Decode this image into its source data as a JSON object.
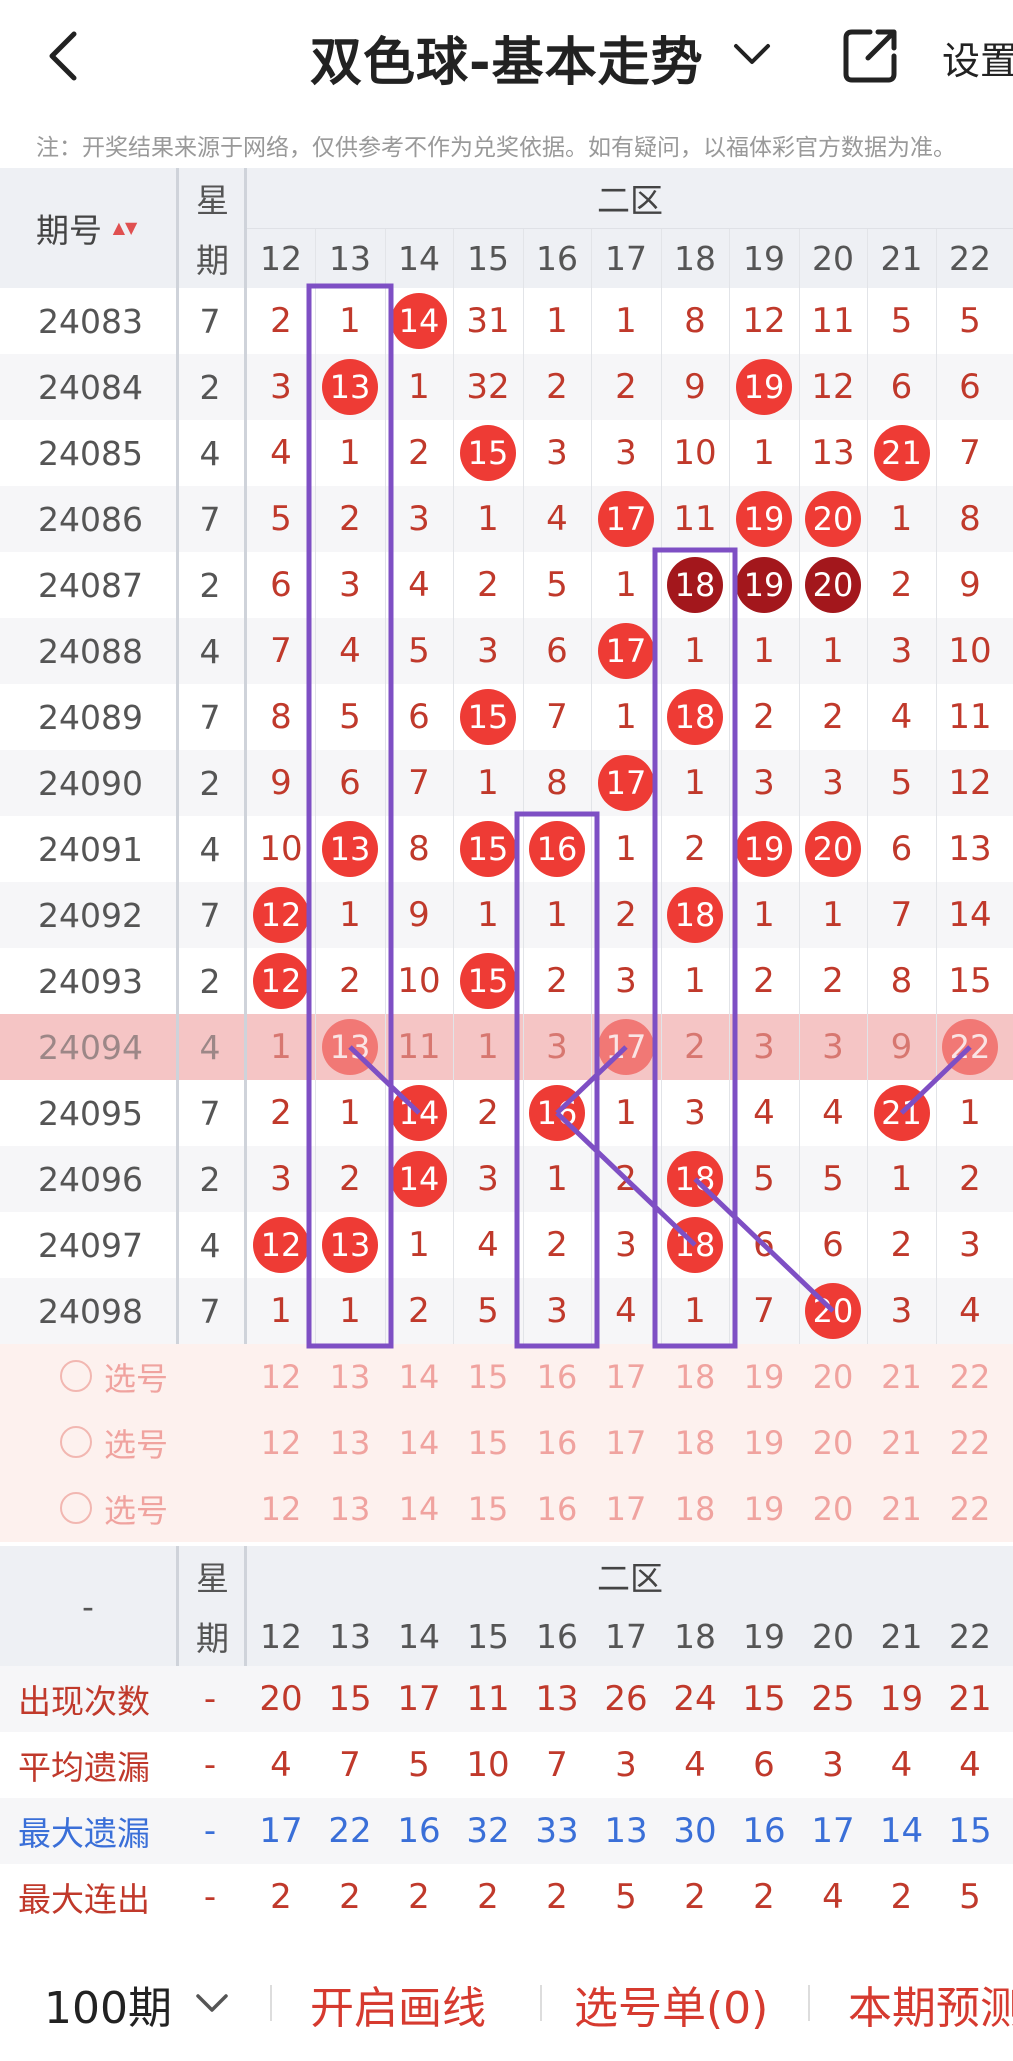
{
  "header": {
    "title": "双色球-基本走势",
    "settings_label": "设置",
    "notice": "注：开奖结果来源于网络，仅供参考不作为兑奖依据。如有疑问，以福体彩官方数据为准。"
  },
  "table": {
    "issue_header": "期号",
    "sort_arrow": "▲▼",
    "week_header": [
      "星",
      "期"
    ],
    "zone_label": "二区",
    "columns": [
      "12",
      "13",
      "14",
      "15",
      "16",
      "17",
      "18",
      "19",
      "20",
      "21",
      "22"
    ],
    "rows": [
      {
        "issue": "24083",
        "week": "7",
        "cells": [
          "2",
          "1",
          "14",
          "31",
          "1",
          "1",
          "8",
          "12",
          "11",
          "5",
          "5"
        ]
      },
      {
        "issue": "24084",
        "week": "2",
        "cells": [
          "3",
          "13",
          "1",
          "32",
          "2",
          "2",
          "9",
          "19",
          "12",
          "6",
          "6"
        ]
      },
      {
        "issue": "24085",
        "week": "4",
        "cells": [
          "4",
          "1",
          "2",
          "15",
          "3",
          "3",
          "10",
          "1",
          "13",
          "21",
          "7"
        ]
      },
      {
        "issue": "24086",
        "week": "7",
        "cells": [
          "5",
          "2",
          "3",
          "1",
          "4",
          "17",
          "11",
          "19",
          "20",
          "1",
          "8"
        ]
      },
      {
        "issue": "24087",
        "week": "2",
        "cells": [
          "6",
          "3",
          "4",
          "2",
          "5",
          "1",
          "18",
          "19",
          "20",
          "2",
          "9"
        ]
      },
      {
        "issue": "24088",
        "week": "4",
        "cells": [
          "7",
          "4",
          "5",
          "3",
          "6",
          "17",
          "1",
          "1",
          "1",
          "3",
          "10"
        ]
      },
      {
        "issue": "24089",
        "week": "7",
        "cells": [
          "8",
          "5",
          "6",
          "15",
          "7",
          "1",
          "18",
          "2",
          "2",
          "4",
          "11"
        ]
      },
      {
        "issue": "24090",
        "week": "2",
        "cells": [
          "9",
          "6",
          "7",
          "1",
          "8",
          "17",
          "1",
          "3",
          "3",
          "5",
          "12"
        ]
      },
      {
        "issue": "24091",
        "week": "4",
        "cells": [
          "10",
          "13",
          "8",
          "15",
          "16",
          "1",
          "2",
          "19",
          "20",
          "6",
          "13"
        ]
      },
      {
        "issue": "24092",
        "week": "7",
        "cells": [
          "12",
          "1",
          "9",
          "1",
          "1",
          "2",
          "18",
          "1",
          "1",
          "7",
          "14"
        ]
      },
      {
        "issue": "24093",
        "week": "2",
        "cells": [
          "12",
          "2",
          "10",
          "15",
          "2",
          "3",
          "1",
          "2",
          "2",
          "8",
          "15"
        ]
      },
      {
        "issue": "24094",
        "week": "4",
        "cells": [
          "1",
          "13",
          "11",
          "1",
          "3",
          "17",
          "2",
          "3",
          "3",
          "9",
          "22"
        ]
      },
      {
        "issue": "24095",
        "week": "7",
        "cells": [
          "2",
          "1",
          "14",
          "2",
          "16",
          "1",
          "3",
          "4",
          "4",
          "21",
          "1"
        ]
      },
      {
        "issue": "24096",
        "week": "2",
        "cells": [
          "3",
          "2",
          "14",
          "3",
          "1",
          "2",
          "18",
          "5",
          "5",
          "1",
          "2"
        ]
      },
      {
        "issue": "24097",
        "week": "4",
        "cells": [
          "12",
          "13",
          "1",
          "4",
          "2",
          "3",
          "18",
          "6",
          "6",
          "2",
          "3"
        ]
      },
      {
        "issue": "24098",
        "week": "7",
        "cells": [
          "1",
          "1",
          "2",
          "5",
          "3",
          "4",
          "1",
          "7",
          "20",
          "3",
          "4"
        ]
      }
    ],
    "balls": [
      [
        0,
        2
      ],
      [
        1,
        1
      ],
      [
        1,
        7
      ],
      [
        2,
        3
      ],
      [
        2,
        9
      ],
      [
        3,
        5
      ],
      [
        3,
        7
      ],
      [
        3,
        8
      ],
      [
        4,
        6
      ],
      [
        4,
        7
      ],
      [
        4,
        8
      ],
      [
        5,
        5
      ],
      [
        6,
        3
      ],
      [
        6,
        6
      ],
      [
        7,
        5
      ],
      [
        8,
        1
      ],
      [
        8,
        3
      ],
      [
        8,
        4
      ],
      [
        8,
        7
      ],
      [
        8,
        8
      ],
      [
        9,
        0
      ],
      [
        9,
        6
      ],
      [
        10,
        0
      ],
      [
        10,
        3
      ],
      [
        11,
        1
      ],
      [
        11,
        5
      ],
      [
        11,
        10
      ],
      [
        12,
        2
      ],
      [
        12,
        4
      ],
      [
        12,
        9
      ],
      [
        13,
        2
      ],
      [
        13,
        6
      ],
      [
        14,
        0
      ],
      [
        14,
        1
      ],
      [
        14,
        6
      ],
      [
        15,
        8
      ]
    ],
    "dark_balls": [
      [
        4,
        6
      ],
      [
        4,
        7
      ],
      [
        4,
        8
      ]
    ],
    "highlight_row": 11,
    "select_label": "选号",
    "select_rows": 3
  },
  "stats": {
    "dash": "-",
    "week_header": [
      "星",
      "期"
    ],
    "zone_label": "二区",
    "rows": [
      {
        "label": "出现次数",
        "color": "#c0392b",
        "values": [
          "20",
          "15",
          "17",
          "11",
          "13",
          "26",
          "24",
          "15",
          "25",
          "19",
          "21"
        ]
      },
      {
        "label": "平均遗漏",
        "color": "#c0392b",
        "values": [
          "4",
          "7",
          "5",
          "10",
          "7",
          "3",
          "4",
          "6",
          "3",
          "4",
          "4"
        ]
      },
      {
        "label": "最大遗漏",
        "color": "#3a6fd8",
        "values": [
          "17",
          "22",
          "16",
          "32",
          "33",
          "13",
          "30",
          "16",
          "17",
          "14",
          "15"
        ]
      },
      {
        "label": "最大连出",
        "color": "#c0392b",
        "values": [
          "2",
          "2",
          "2",
          "2",
          "2",
          "5",
          "2",
          "2",
          "4",
          "2",
          "5"
        ]
      }
    ]
  },
  "bottom_bar": {
    "period": "100期",
    "draw_lines": "开启画线",
    "selection_list": "选号单(0)",
    "prediction": "本期预测"
  },
  "colors": {
    "ball": "#ee3b35",
    "ball_dark": "#a3171c",
    "accent_purple": "#7e4fc4",
    "highlight_row": "#f5c5c5",
    "select_bg": "#fdf1ee"
  }
}
